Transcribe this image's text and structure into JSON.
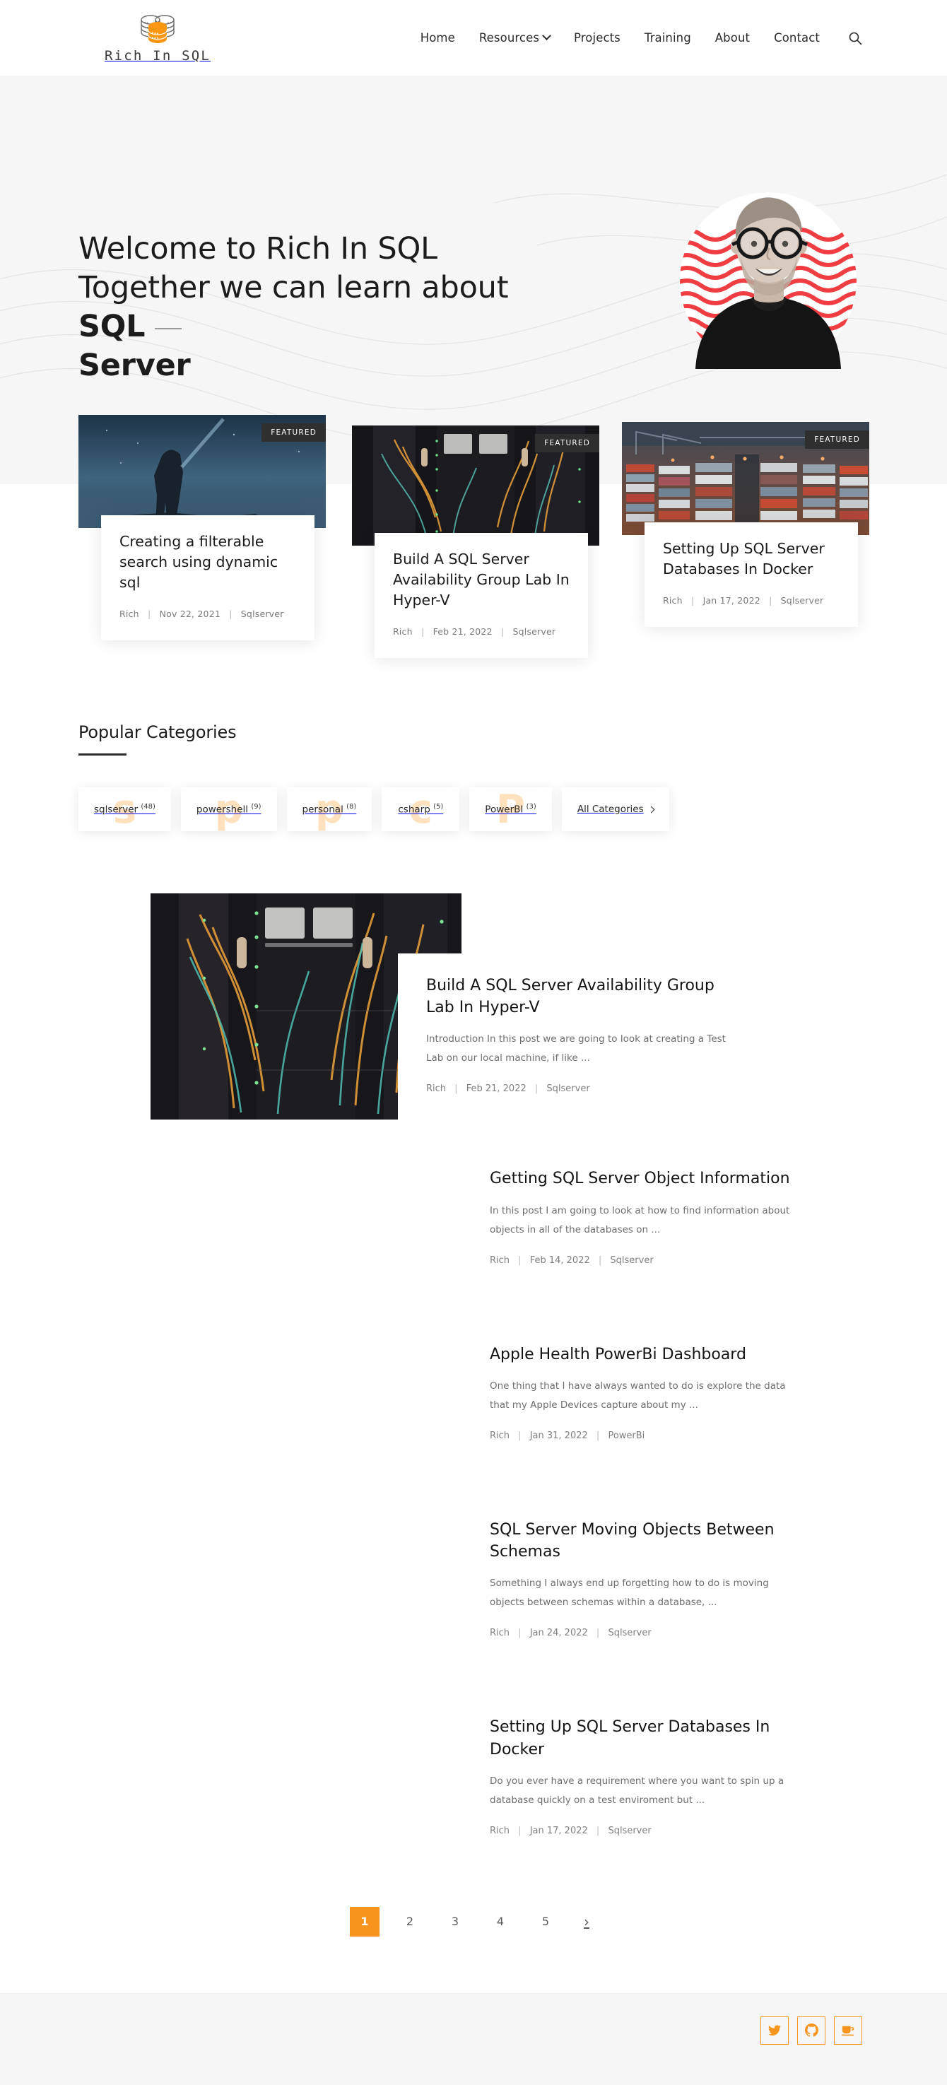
{
  "brand": {
    "logo_text": "Rich In SQL",
    "accent_color": "#f7941d",
    "dark_color": "#2f2f2f"
  },
  "nav": {
    "items": [
      {
        "label": "Home",
        "has_dropdown": false
      },
      {
        "label": "Resources",
        "has_dropdown": true
      },
      {
        "label": "Projects",
        "has_dropdown": false
      },
      {
        "label": "Training",
        "has_dropdown": false
      },
      {
        "label": "About",
        "has_dropdown": false
      },
      {
        "label": "Contact",
        "has_dropdown": false
      }
    ],
    "search_icon": "search-icon"
  },
  "hero": {
    "line1": "Welcome to Rich In SQL",
    "line2_prefix": "Together we can learn about ",
    "line2_bold": "SQL",
    "line3_bold": "Server",
    "avatar_alt": "portrait-photo"
  },
  "featured": {
    "badge_label": "FEATURED",
    "cards": [
      {
        "title": "Creating a filterable search using dynamic sql",
        "author": "Rich",
        "date": "Nov 22, 2021",
        "category": "Sqlserver",
        "image": "night-sky-person-silhouette"
      },
      {
        "title": "Build A SQL Server Availability Group Lab In Hyper-V",
        "author": "Rich",
        "date": "Feb 21, 2022",
        "category": "Sqlserver",
        "image": "server-rack-cables"
      },
      {
        "title": "Setting Up SQL Server Databases In Docker",
        "author": "Rich",
        "date": "Jan 17, 2022",
        "category": "Sqlserver",
        "image": "shipping-container-port"
      }
    ]
  },
  "categories": {
    "heading": "Popular Categories",
    "items": [
      {
        "name": "sqlserver",
        "count": "(48)",
        "ghost": "s"
      },
      {
        "name": "powershell",
        "count": "(9)",
        "ghost": "p"
      },
      {
        "name": "personal",
        "count": "(8)",
        "ghost": "p"
      },
      {
        "name": "csharp",
        "count": "(5)",
        "ghost": "c"
      },
      {
        "name": "PowerBI",
        "count": "(3)",
        "ghost": "P"
      }
    ],
    "all_label": "All Categories"
  },
  "posts": [
    {
      "title": "Build A SQL Server Availability Group Lab In Hyper-V",
      "excerpt": "Introduction In this post we are going to look at creating a Test Lab on our local machine, if like ...",
      "author": "Rich",
      "date": "Feb 21, 2022",
      "category": "Sqlserver",
      "has_image": true,
      "image": "server-rack-cables"
    },
    {
      "title": "Getting SQL Server Object Information",
      "excerpt": "In this post I am going to look at how to find information about objects in all of the databases on ...",
      "author": "Rich",
      "date": "Feb 14, 2022",
      "category": "Sqlserver",
      "has_image": false,
      "image": ""
    },
    {
      "title": "Apple Health PowerBi Dashboard",
      "excerpt": "One thing that I have always wanted to do is explore the data that my Apple Devices capture about my ...",
      "author": "Rich",
      "date": "Jan 31, 2022",
      "category": "PowerBi",
      "has_image": false,
      "image": ""
    },
    {
      "title": "SQL Server Moving Objects Between Schemas",
      "excerpt": "Something I always end up forgetting how to do is moving objects between schemas within a database, ...",
      "author": "Rich",
      "date": "Jan 24, 2022",
      "category": "Sqlserver",
      "has_image": false,
      "image": ""
    },
    {
      "title": "Setting Up SQL Server Databases In Docker",
      "excerpt": "Do you ever have a requirement where you want to spin up a database quickly on a test enviroment but ...",
      "author": "Rich",
      "date": "Jan 17, 2022",
      "category": "Sqlserver",
      "has_image": false,
      "image": ""
    }
  ],
  "pagination": {
    "pages": [
      "1",
      "2",
      "3",
      "4",
      "5"
    ],
    "active": "1",
    "next_label": "›"
  },
  "footer": {
    "social": [
      {
        "name": "twitter-icon"
      },
      {
        "name": "github-icon"
      },
      {
        "name": "coffee-icon"
      }
    ]
  }
}
